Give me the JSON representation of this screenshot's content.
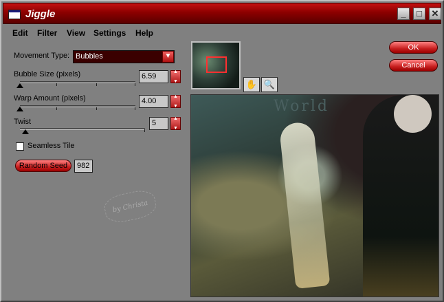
{
  "window": {
    "title": "Jiggle"
  },
  "titlebar_buttons": [
    "_",
    "□",
    "✕"
  ],
  "menu": [
    "Edit",
    "Filter",
    "View",
    "Settings",
    "Help"
  ],
  "movement_type": {
    "label": "Movement Type:",
    "value": "Bubbles"
  },
  "bubble_size": {
    "label": "Bubble Size (pixels)",
    "value": "6.59",
    "slider_fraction": 0.05
  },
  "warp_amount": {
    "label": "Warp Amount (pixels)",
    "value": "4.00",
    "slider_fraction": 0.05
  },
  "twist": {
    "label": "Twist",
    "value": "5",
    "slider_fraction": 0.05
  },
  "seamless": {
    "label": "Seamless Tile",
    "checked": false
  },
  "random_seed": {
    "label": "Random Seed",
    "value": "982"
  },
  "buttons": {
    "ok": "OK",
    "cancel": "Cancel"
  },
  "tools": {
    "hand_icon": "✋",
    "zoom_icon": "🔍"
  },
  "preview": {
    "word": "World"
  },
  "watermark": {
    "text": "by Christa"
  },
  "colors": {
    "accent": "#c41010",
    "title_dark": "#5a0000",
    "button": "#c82020"
  }
}
